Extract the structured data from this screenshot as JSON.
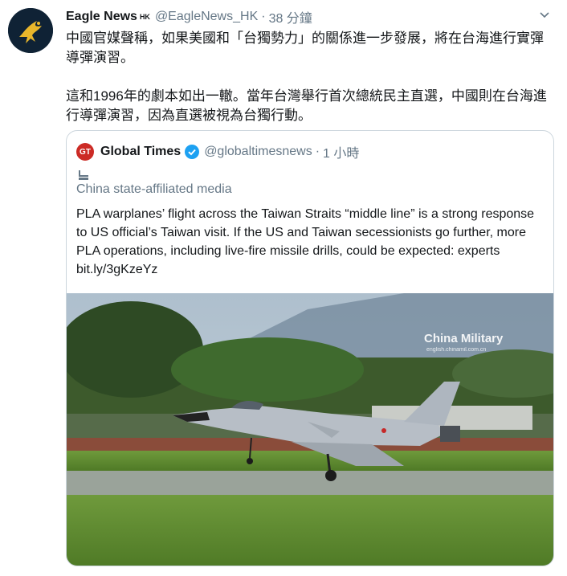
{
  "tweet": {
    "author_name": "Eagle News",
    "author_badge": "HK",
    "handle": "@EagleNews_HK",
    "separator": "·",
    "time": "38 分鐘",
    "paragraph1": "中國官媒聲稱，如果美國和「台獨勢力」的關係進一步發展，將在台海進行實彈導彈演習。",
    "paragraph2": "這和1996年的劇本如出一轍。當年台灣舉行首次總統民主直選，中國則在台海進行導彈演習，因為直選被視為台獨行動。"
  },
  "quoted": {
    "logo_text": "GT",
    "name": "Global Times",
    "handle": "@globaltimesnews",
    "separator": "·",
    "time": "1 小時",
    "label": "China state-affiliated media",
    "text": "PLA warplanes’ flight across the Taiwan Straits “middle line” is a strong response to US official’s Taiwan visit. If the US and Taiwan secessionists go further, more PLA operations, including live-fire missile drills, could be expected: experts bit.ly/3gKzeYz",
    "image_watermark": "China Military",
    "image_watermark_sub": "english.chinamil.com.cn"
  },
  "icons": {
    "avatar": "eagle-logo",
    "more": "chevron-down-icon",
    "verified": "verified-badge-icon",
    "state_media": "state-media-icon"
  },
  "colors": {
    "text": "#14171a",
    "secondary": "#657786",
    "border": "#ccd6dd",
    "verified": "#1da1f2",
    "gt_red": "#cc2b25"
  }
}
